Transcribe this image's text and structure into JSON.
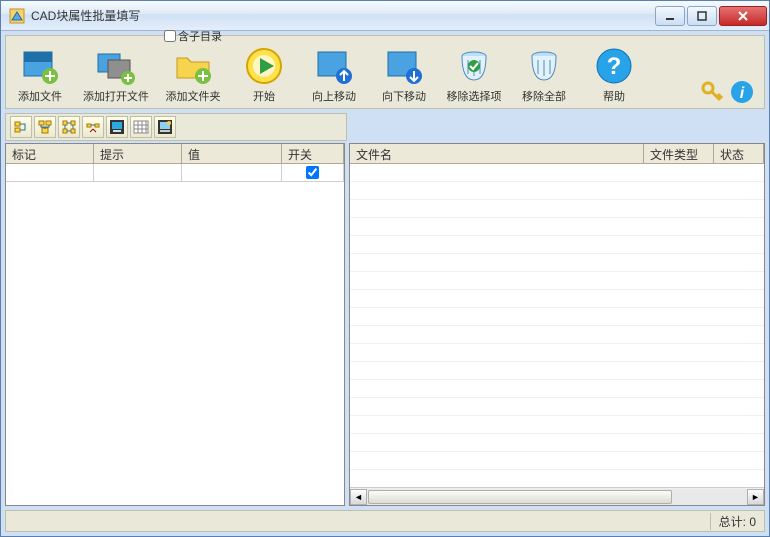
{
  "window": {
    "title": "CAD块属性批量填写"
  },
  "toolbar": {
    "include_sub": "含子目录",
    "items": [
      {
        "label": "添加文件"
      },
      {
        "label": "添加打开文件"
      },
      {
        "label": "添加文件夹"
      },
      {
        "label": "开始"
      },
      {
        "label": "向上移动"
      },
      {
        "label": "向下移动"
      },
      {
        "label": "移除选择项"
      },
      {
        "label": "移除全部"
      },
      {
        "label": "帮助"
      }
    ]
  },
  "left_grid": {
    "cols": [
      "标记",
      "提示",
      "值",
      "开关"
    ],
    "row": {
      "checked": true
    }
  },
  "right_grid": {
    "cols": [
      "文件名",
      "文件类型",
      "状态"
    ]
  },
  "status": {
    "total_label": "总计:",
    "total_value": "0"
  }
}
